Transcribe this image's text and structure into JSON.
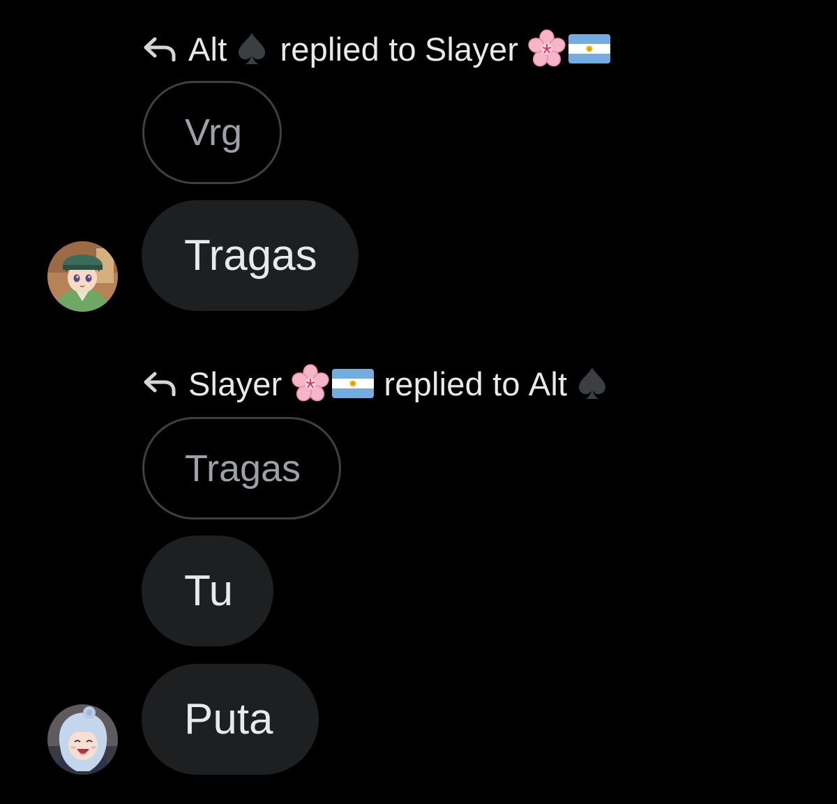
{
  "thread": [
    {
      "reply_header": {
        "author": "Alt",
        "verb": "replied to",
        "target": "Slayer",
        "author_emojis": [
          "spade-icon"
        ],
        "target_emojis": [
          "cherry-blossom-icon",
          "argentina-flag-icon"
        ]
      },
      "quoted_text": "Vrg",
      "messages": [
        "Tragas"
      ],
      "avatar": "anime-boy-green-hat-avatar"
    },
    {
      "reply_header": {
        "author": "Slayer",
        "verb": "replied to",
        "target": "Alt",
        "author_emojis": [
          "cherry-blossom-icon",
          "argentina-flag-icon"
        ],
        "target_emojis": [
          "spade-icon"
        ]
      },
      "quoted_text": "Tragas",
      "messages": [
        "Tu",
        "Puta"
      ],
      "avatar": "anime-girl-blue-hair-avatar"
    }
  ],
  "colors": {
    "background": "#000000",
    "text": "#e7e9ea",
    "quoted_text": "#9aa1a8",
    "quote_border": "#3e4144",
    "bubble": "#1d1f21"
  }
}
